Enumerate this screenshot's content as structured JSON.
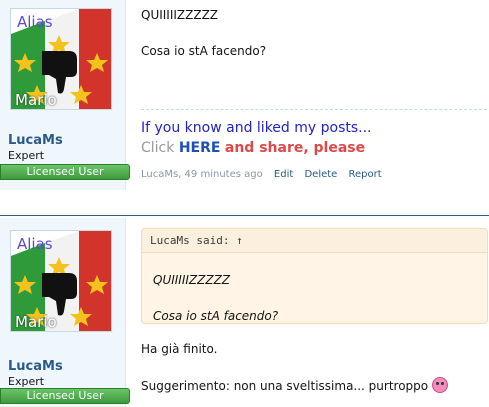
{
  "posts": [
    {
      "author": {
        "username": "LucaMs",
        "title": "Expert",
        "banner": "Licensed User",
        "avatar": {
          "top_text": "Alias",
          "bottom_text": "Mario"
        }
      },
      "message": {
        "line1": "QUIIIIIZZZZZ",
        "line2": "Cosa io stA facendo?"
      },
      "signature": {
        "line1": "If you know and liked my posts...",
        "click": "Click",
        "here": "HERE",
        "share": "and share, please"
      },
      "meta": {
        "author_time": "LucaMs, 49 minutes ago",
        "edit": "Edit",
        "delete": "Delete",
        "report": "Report"
      }
    },
    {
      "author": {
        "username": "LucaMs",
        "title": "Expert",
        "banner": "Licensed User",
        "avatar": {
          "top_text": "Alias",
          "bottom_text": "Mario"
        }
      },
      "quote": {
        "header": "LucaMs said: ↑",
        "line1": "QUIIIIIZZZZZ",
        "line2": "Cosa io stA facendo?"
      },
      "message": {
        "line1": "Ha già finito.",
        "line2": "Suggerimento: non una sveltissima... purtroppo"
      },
      "emoji_icon": "tongue-out-emoji-icon"
    }
  ],
  "colors": {
    "username": "#2b5a8a",
    "banner": "#3d9b3b",
    "signature_blue": "#2222cc",
    "share_red": "#e04848"
  }
}
